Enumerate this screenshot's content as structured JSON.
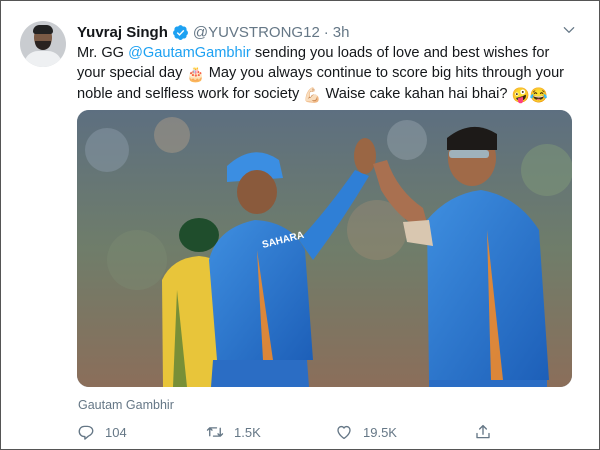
{
  "tweet": {
    "author_name": "Yuvraj Singh",
    "handle": "@YUVSTRONG12",
    "separator": "·",
    "time": "3h",
    "text": {
      "part1": "Mr. GG ",
      "mention": "@GautamGambhir",
      "part2": " sending you loads of love and best wishes for your special day ",
      "emoji_cake": "🎂",
      "part3": " May you always continue to score big hits through your noble and selfless work for society ",
      "emoji_muscle": "💪🏻",
      "part4": "  Waise cake kahan hai bhai? ",
      "emoji_crazy": "🤪",
      "emoji_joy": "😂"
    },
    "media": {
      "jersey_text": "SAHARA"
    },
    "tagged_user": "Gautam Gambhir",
    "stats": {
      "replies": "104",
      "retweets": "1.5K",
      "likes": "19.5K"
    }
  },
  "colors": {
    "accent": "#1da1f2",
    "secondary_text": "#657786",
    "primary_text": "#14171a"
  },
  "icons": [
    "verified-badge-icon",
    "caret-down-icon",
    "reply-icon",
    "retweet-icon",
    "like-icon",
    "share-icon",
    "user-tag-icon"
  ]
}
